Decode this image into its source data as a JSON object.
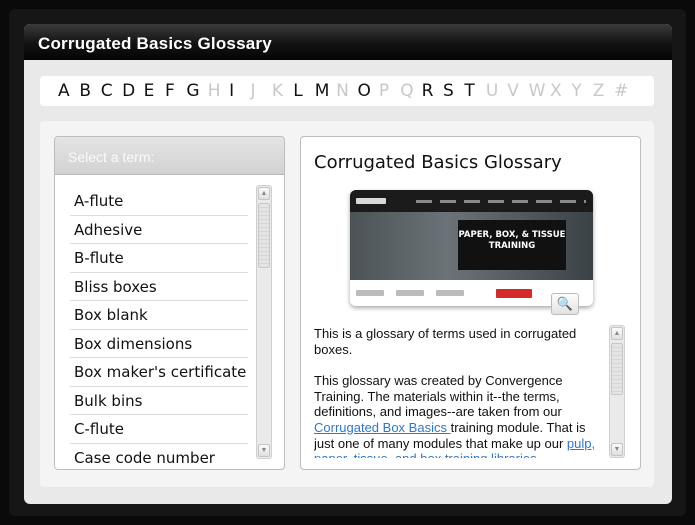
{
  "window": {
    "title": "Corrugated Basics Glossary"
  },
  "alphabet": [
    {
      "letter": "A",
      "enabled": true
    },
    {
      "letter": "B",
      "enabled": true
    },
    {
      "letter": "C",
      "enabled": true
    },
    {
      "letter": "D",
      "enabled": true
    },
    {
      "letter": "E",
      "enabled": true
    },
    {
      "letter": "F",
      "enabled": true
    },
    {
      "letter": "G",
      "enabled": true
    },
    {
      "letter": "H",
      "enabled": false
    },
    {
      "letter": "I",
      "enabled": true
    },
    {
      "letter": "J",
      "enabled": false
    },
    {
      "letter": "K",
      "enabled": false
    },
    {
      "letter": "L",
      "enabled": true
    },
    {
      "letter": "M",
      "enabled": true
    },
    {
      "letter": "N",
      "enabled": false
    },
    {
      "letter": "O",
      "enabled": true
    },
    {
      "letter": "P",
      "enabled": false
    },
    {
      "letter": "Q",
      "enabled": false
    },
    {
      "letter": "R",
      "enabled": true
    },
    {
      "letter": "S",
      "enabled": true
    },
    {
      "letter": "T",
      "enabled": true
    },
    {
      "letter": "U",
      "enabled": false
    },
    {
      "letter": "V",
      "enabled": false
    },
    {
      "letter": "W",
      "enabled": false
    },
    {
      "letter": "X",
      "enabled": false
    },
    {
      "letter": "Y",
      "enabled": false
    },
    {
      "letter": "Z",
      "enabled": false
    },
    {
      "letter": "#",
      "enabled": false
    }
  ],
  "terms": {
    "header": "Select a term:",
    "items": [
      "A-flute",
      "Adhesive",
      "B-flute",
      "Bliss boxes",
      "Box blank",
      "Box dimensions",
      "Box maker's certificate",
      "Bulk bins",
      "C-flute",
      "Case code number"
    ]
  },
  "detail": {
    "title": "Corrugated Basics Glossary",
    "thumbnail_banner": "PAPER, BOX, & TISSUE TRAINING",
    "zoom_icon": "magnifier-icon",
    "paragraph1": "This is a glossary of terms used in corrugated boxes.",
    "paragraph2_before": "This glossary was created by Convergence Training. The materials within it--the terms, definitions, and images--are taken from our ",
    "link1": "Corrugated Box Basics ",
    "paragraph2_middle": "training module. That is just one of many modules that make up our ",
    "link2": "pulp, paper, tissue, and box training libraries",
    "paragraph2_after": "."
  },
  "colors": {
    "link": "#2f77c7",
    "disabled_letter": "#c8c8c8",
    "titlebar": "#121212"
  }
}
